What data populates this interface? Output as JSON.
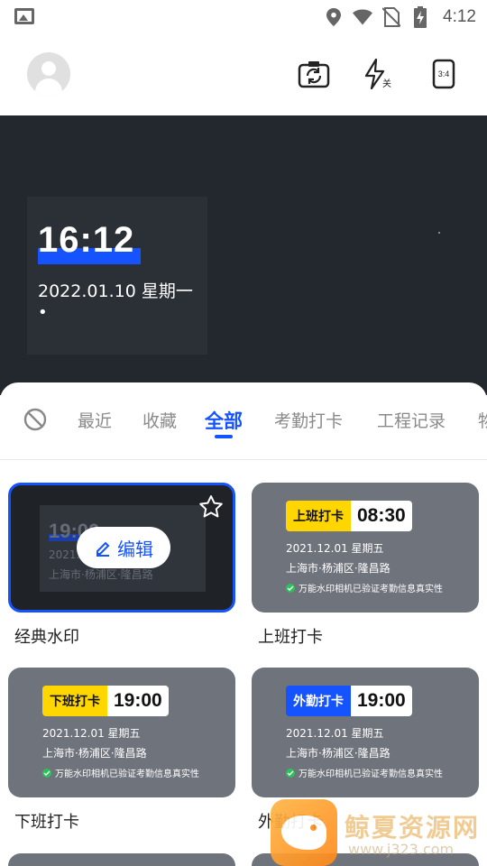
{
  "status_bar": {
    "time": "4:12",
    "icons": [
      "image-icon",
      "location-icon",
      "wifi-icon",
      "no-sim-icon",
      "battery-charging-icon"
    ]
  },
  "top_bar": {
    "avatar_icon": "user-avatar-icon",
    "actions": [
      {
        "icon": "switch-camera-icon"
      },
      {
        "icon": "flash-off-icon",
        "label": "关"
      },
      {
        "icon": "aspect-ratio-icon",
        "label": "3:4"
      }
    ]
  },
  "preview": {
    "watermark": {
      "time": "16:12",
      "date": "2022.01.10 星期一",
      "dot": "•"
    }
  },
  "tabs": {
    "none_icon": "no-watermark-icon",
    "items": [
      {
        "label": "最近",
        "active": false
      },
      {
        "label": "收藏",
        "active": false
      },
      {
        "label": "全部",
        "active": true
      },
      {
        "label": "考勤打卡",
        "active": false
      },
      {
        "label": "工程记录",
        "active": false
      },
      {
        "label": "物",
        "active": false
      }
    ]
  },
  "templates": [
    {
      "name": "经典水印",
      "selected": true,
      "preview_time": "19:00",
      "preview_date": "2021.12.0",
      "preview_location": "上海市·杨浦区·隆昌路",
      "edit_label": "编辑",
      "favorite_icon": "star-outline-icon"
    },
    {
      "name": "上班打卡",
      "tag": "上班打卡",
      "tag_color": "#ffd600",
      "time": "08:30",
      "date": "2021.12.01  星期五",
      "location": "上海市·杨浦区·隆昌路",
      "verify": "万能水印相机已验证考勤信息真实性"
    },
    {
      "name": "下班打卡",
      "tag": "下班打卡",
      "tag_color": "#ffd600",
      "time": "19:00",
      "date": "2021.12.01   星期五",
      "location": "上海市·杨浦区·隆昌路",
      "verify": "万能水印相机已验证考勤信息真实性"
    },
    {
      "name": "外勤打卡",
      "tag": "外勤打卡",
      "tag_color": "#1553ff",
      "time": "19:00",
      "date": "2021.12.01   星期五",
      "location": "上海市·杨浦区·隆昌路",
      "verify": "万能水印相机已验证考勤信息真实性"
    }
  ],
  "site_watermark": {
    "text": "鲸夏资源网",
    "url": "www.j323.com"
  },
  "colors": {
    "accent": "#1553ff",
    "tag_yellow": "#ffd600",
    "preview_bg": "#23272e",
    "card_bg": "#6f737c"
  }
}
